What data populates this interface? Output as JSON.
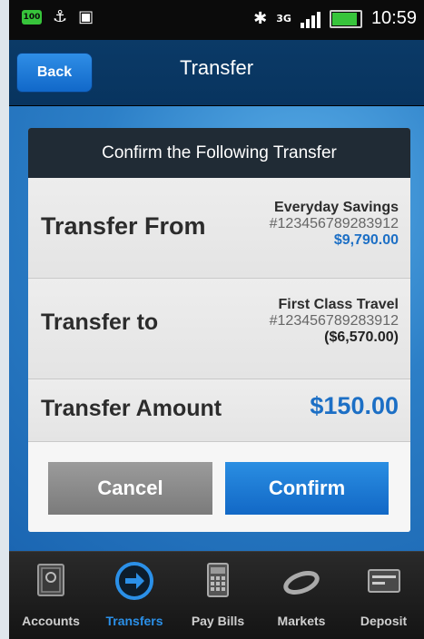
{
  "status_bar": {
    "battery_small": "100",
    "time": "10:59",
    "network": "3G"
  },
  "header": {
    "back_label": "Back",
    "title": "Transfer"
  },
  "confirm": {
    "title": "Confirm the Following Transfer",
    "from": {
      "label": "Transfer From",
      "account_name": "Everyday Savings",
      "account_number": "#123456789283912",
      "balance": "$9,790.00"
    },
    "to": {
      "label": "Transfer to",
      "account_name": "First Class Travel",
      "account_number": "#123456789283912",
      "balance": "($6,570.00)"
    },
    "amount": {
      "label": "Transfer Amount",
      "value": "$150.00"
    },
    "cancel_label": "Cancel",
    "confirm_label": "Confirm"
  },
  "tabs": [
    {
      "label": "Accounts",
      "icon": "safe-icon"
    },
    {
      "label": "Transfers",
      "icon": "arrow-circle-icon",
      "active": true
    },
    {
      "label": "Pay Bills",
      "icon": "calculator-icon"
    },
    {
      "label": "Markets",
      "icon": "bracelet-icon"
    },
    {
      "label": "Deposit",
      "icon": "check-card-icon"
    }
  ],
  "colors": {
    "accent": "#1c6fc5",
    "header": "#0b3a67",
    "active_tab": "#2b90e8"
  }
}
